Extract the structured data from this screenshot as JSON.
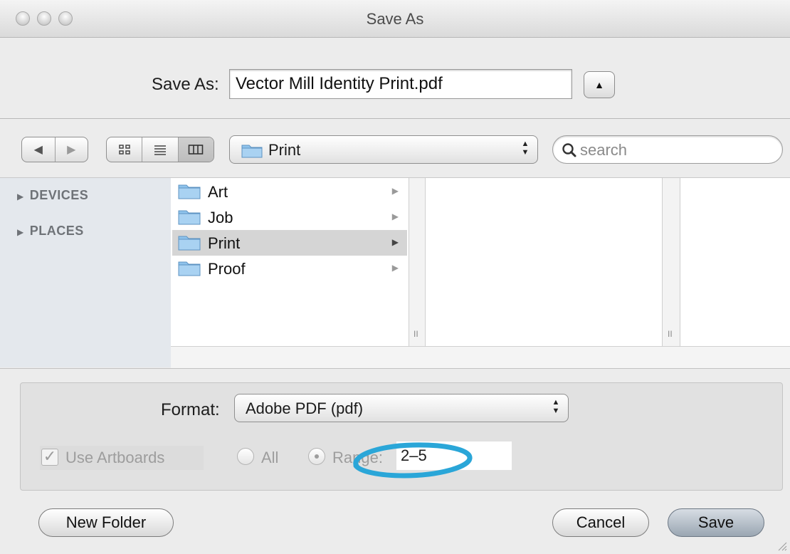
{
  "window": {
    "title": "Save As"
  },
  "save_as": {
    "label": "Save As:",
    "filename": "Vector Mill Identity Print.pdf"
  },
  "toolbar": {
    "back_icon": "triangle-left",
    "forward_icon": "triangle-right",
    "view_modes": [
      "icon-view",
      "list-view",
      "column-view"
    ],
    "active_view": "column-view",
    "location": "Print",
    "search_placeholder": "search"
  },
  "sidebar": {
    "sections": [
      "DEVICES",
      "PLACES"
    ]
  },
  "browser": {
    "column1": [
      {
        "name": "Art",
        "selected": false
      },
      {
        "name": "Job",
        "selected": false
      },
      {
        "name": "Print",
        "selected": true
      },
      {
        "name": "Proof",
        "selected": false
      }
    ]
  },
  "options": {
    "format_label": "Format:",
    "format_value": "Adobe PDF (pdf)",
    "use_artboards_label": "Use Artboards",
    "use_artboards_checked": true,
    "all_label": "All",
    "range_label": "Range:",
    "range_selected": true,
    "range_value": "2–5",
    "annotation_color": "#2aa6d8"
  },
  "buttons": {
    "new_folder": "New Folder",
    "cancel": "Cancel",
    "save": "Save"
  },
  "colors": {
    "sidebar_bg": "#e4e8ed",
    "selection": "#d5d5d5",
    "folder_blue": "#8fc3ec"
  }
}
